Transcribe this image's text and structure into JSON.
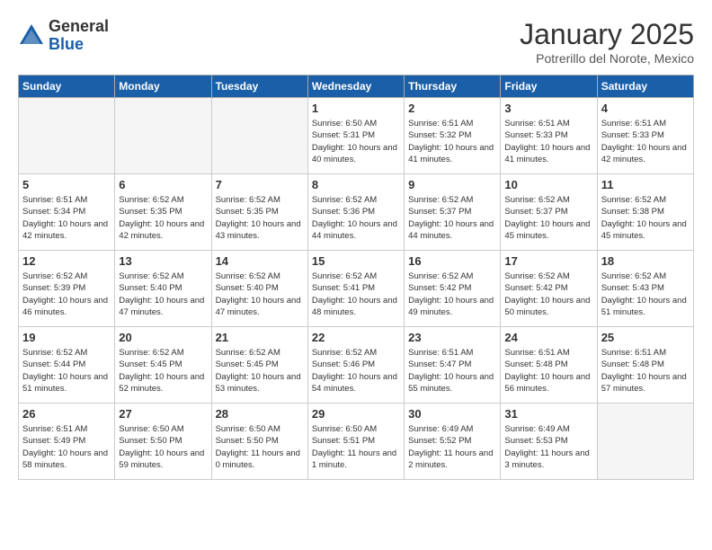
{
  "header": {
    "logo_general": "General",
    "logo_blue": "Blue",
    "title": "January 2025",
    "location": "Potrerillo del Norote, Mexico"
  },
  "days_of_week": [
    "Sunday",
    "Monday",
    "Tuesday",
    "Wednesday",
    "Thursday",
    "Friday",
    "Saturday"
  ],
  "weeks": [
    [
      {
        "day": "",
        "empty": true
      },
      {
        "day": "",
        "empty": true
      },
      {
        "day": "",
        "empty": true
      },
      {
        "day": "1",
        "sunrise": "6:50 AM",
        "sunset": "5:31 PM",
        "daylight": "10 hours and 40 minutes."
      },
      {
        "day": "2",
        "sunrise": "6:51 AM",
        "sunset": "5:32 PM",
        "daylight": "10 hours and 41 minutes."
      },
      {
        "day": "3",
        "sunrise": "6:51 AM",
        "sunset": "5:33 PM",
        "daylight": "10 hours and 41 minutes."
      },
      {
        "day": "4",
        "sunrise": "6:51 AM",
        "sunset": "5:33 PM",
        "daylight": "10 hours and 42 minutes."
      }
    ],
    [
      {
        "day": "5",
        "sunrise": "6:51 AM",
        "sunset": "5:34 PM",
        "daylight": "10 hours and 42 minutes."
      },
      {
        "day": "6",
        "sunrise": "6:52 AM",
        "sunset": "5:35 PM",
        "daylight": "10 hours and 42 minutes."
      },
      {
        "day": "7",
        "sunrise": "6:52 AM",
        "sunset": "5:35 PM",
        "daylight": "10 hours and 43 minutes."
      },
      {
        "day": "8",
        "sunrise": "6:52 AM",
        "sunset": "5:36 PM",
        "daylight": "10 hours and 44 minutes."
      },
      {
        "day": "9",
        "sunrise": "6:52 AM",
        "sunset": "5:37 PM",
        "daylight": "10 hours and 44 minutes."
      },
      {
        "day": "10",
        "sunrise": "6:52 AM",
        "sunset": "5:37 PM",
        "daylight": "10 hours and 45 minutes."
      },
      {
        "day": "11",
        "sunrise": "6:52 AM",
        "sunset": "5:38 PM",
        "daylight": "10 hours and 45 minutes."
      }
    ],
    [
      {
        "day": "12",
        "sunrise": "6:52 AM",
        "sunset": "5:39 PM",
        "daylight": "10 hours and 46 minutes."
      },
      {
        "day": "13",
        "sunrise": "6:52 AM",
        "sunset": "5:40 PM",
        "daylight": "10 hours and 47 minutes."
      },
      {
        "day": "14",
        "sunrise": "6:52 AM",
        "sunset": "5:40 PM",
        "daylight": "10 hours and 47 minutes."
      },
      {
        "day": "15",
        "sunrise": "6:52 AM",
        "sunset": "5:41 PM",
        "daylight": "10 hours and 48 minutes."
      },
      {
        "day": "16",
        "sunrise": "6:52 AM",
        "sunset": "5:42 PM",
        "daylight": "10 hours and 49 minutes."
      },
      {
        "day": "17",
        "sunrise": "6:52 AM",
        "sunset": "5:42 PM",
        "daylight": "10 hours and 50 minutes."
      },
      {
        "day": "18",
        "sunrise": "6:52 AM",
        "sunset": "5:43 PM",
        "daylight": "10 hours and 51 minutes."
      }
    ],
    [
      {
        "day": "19",
        "sunrise": "6:52 AM",
        "sunset": "5:44 PM",
        "daylight": "10 hours and 51 minutes."
      },
      {
        "day": "20",
        "sunrise": "6:52 AM",
        "sunset": "5:45 PM",
        "daylight": "10 hours and 52 minutes."
      },
      {
        "day": "21",
        "sunrise": "6:52 AM",
        "sunset": "5:45 PM",
        "daylight": "10 hours and 53 minutes."
      },
      {
        "day": "22",
        "sunrise": "6:52 AM",
        "sunset": "5:46 PM",
        "daylight": "10 hours and 54 minutes."
      },
      {
        "day": "23",
        "sunrise": "6:51 AM",
        "sunset": "5:47 PM",
        "daylight": "10 hours and 55 minutes."
      },
      {
        "day": "24",
        "sunrise": "6:51 AM",
        "sunset": "5:48 PM",
        "daylight": "10 hours and 56 minutes."
      },
      {
        "day": "25",
        "sunrise": "6:51 AM",
        "sunset": "5:48 PM",
        "daylight": "10 hours and 57 minutes."
      }
    ],
    [
      {
        "day": "26",
        "sunrise": "6:51 AM",
        "sunset": "5:49 PM",
        "daylight": "10 hours and 58 minutes."
      },
      {
        "day": "27",
        "sunrise": "6:50 AM",
        "sunset": "5:50 PM",
        "daylight": "10 hours and 59 minutes."
      },
      {
        "day": "28",
        "sunrise": "6:50 AM",
        "sunset": "5:50 PM",
        "daylight": "11 hours and 0 minutes."
      },
      {
        "day": "29",
        "sunrise": "6:50 AM",
        "sunset": "5:51 PM",
        "daylight": "11 hours and 1 minute."
      },
      {
        "day": "30",
        "sunrise": "6:49 AM",
        "sunset": "5:52 PM",
        "daylight": "11 hours and 2 minutes."
      },
      {
        "day": "31",
        "sunrise": "6:49 AM",
        "sunset": "5:53 PM",
        "daylight": "11 hours and 3 minutes."
      },
      {
        "day": "",
        "empty": true
      }
    ]
  ],
  "labels": {
    "sunrise": "Sunrise:",
    "sunset": "Sunset:",
    "daylight": "Daylight:"
  }
}
